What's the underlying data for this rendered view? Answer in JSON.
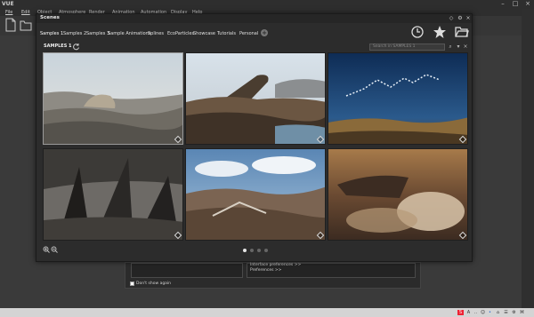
{
  "app": {
    "logo": "VUE"
  },
  "menu": [
    {
      "label": "File"
    },
    {
      "label": "Edit"
    },
    {
      "label": "Object"
    },
    {
      "label": "Atmosphere"
    },
    {
      "label": "Render"
    },
    {
      "label": "Animation"
    },
    {
      "label": "Automation"
    },
    {
      "label": "Display"
    },
    {
      "label": "Help"
    }
  ],
  "dialog": {
    "title": "Scenes",
    "tabs": [
      {
        "label": "Samples 1"
      },
      {
        "label": "Samples 2"
      },
      {
        "label": "Samples 3"
      },
      {
        "label": "Sample Animations"
      },
      {
        "label": "Splines"
      },
      {
        "label": "EcoParticles"
      },
      {
        "label": "Showcase"
      },
      {
        "label": "Tutorials"
      },
      {
        "label": "Personal"
      }
    ],
    "add_tab": "+",
    "section_label": "SAMPLES 1",
    "search_placeholder": "Search in SAMPLES 1",
    "thumbnails": [
      {
        "name": "desert-rock-scene",
        "selected": true
      },
      {
        "name": "cliff-water-scene",
        "selected": false
      },
      {
        "name": "night-particles-scene",
        "selected": false
      },
      {
        "name": "dark-spikes-scene",
        "selected": false
      },
      {
        "name": "canyon-clouds-scene",
        "selected": false
      },
      {
        "name": "sunset-clouds-scene",
        "selected": false
      }
    ],
    "pages": 4,
    "active_page": 0
  },
  "background_panel": {
    "links": [
      "Interface preferences >>",
      "Preferences >>"
    ],
    "dont_show_label": "Don't show again"
  },
  "taskbar": {
    "icons": [
      "S",
      "A",
      "..",
      "☺",
      "•",
      "⌂",
      "☰",
      "⚙",
      "⌘"
    ]
  },
  "colors": {
    "accent": "#e6e6e6",
    "dialog_bg": "#2c2c2c",
    "taskbar_bg": "#d4d4d4"
  }
}
